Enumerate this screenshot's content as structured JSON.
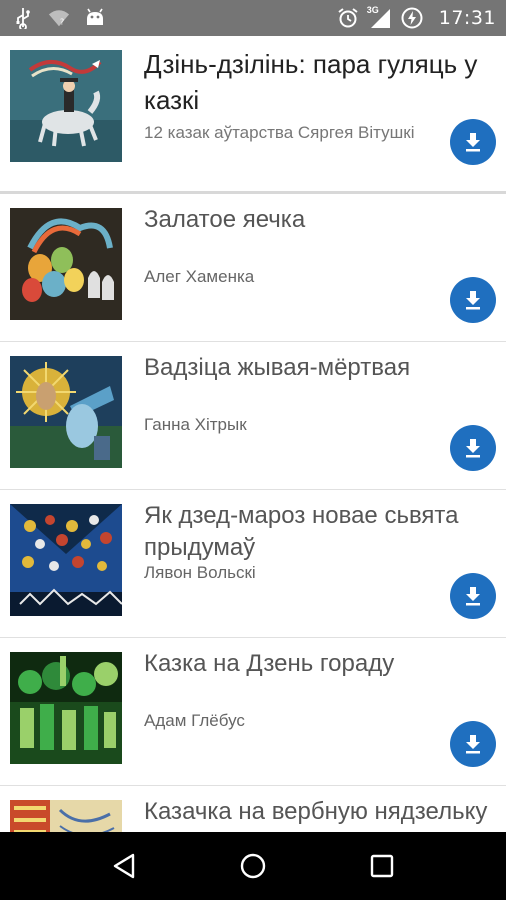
{
  "status_bar": {
    "time": "17:31",
    "network": "3G",
    "icons": [
      "usb-icon",
      "wifi-icon",
      "android-debug-icon",
      "alarm-icon",
      "signal-icon",
      "battery-charging-icon"
    ]
  },
  "books": [
    {
      "title": "Дзінь-дзілінь: пара гуляць у казкі",
      "author": "12 казак аўтарства Сяргея Вітушкі",
      "cover_colors": [
        "#3a6f7c",
        "#e0e4e6",
        "#c23a3a"
      ],
      "icon": "download-icon"
    },
    {
      "title": "Залатое яечка",
      "author": "Алег Хаменка",
      "cover_colors": [
        "#2f2a22",
        "#e8a53a",
        "#6bb0c8"
      ],
      "icon": "download-icon"
    },
    {
      "title": "Вадзіца жывая-мёртвая",
      "author": "Ганна Хітрык",
      "cover_colors": [
        "#1e3f5c",
        "#d9b23a",
        "#5ba0c8"
      ],
      "icon": "download-icon"
    },
    {
      "title": "Як дзед-мароз новае сьвята прыдумаў",
      "author": "Лявон Вольскі",
      "cover_colors": [
        "#1d4b8f",
        "#e2b93b",
        "#c4452f"
      ],
      "icon": "download-icon"
    },
    {
      "title": "Казка на Дзень гораду",
      "author": "Адам Глёбус",
      "cover_colors": [
        "#0f2a10",
        "#3fae4a",
        "#9ad06a"
      ],
      "icon": "download-icon"
    },
    {
      "title": "Казачка на вербную нядзельку",
      "author": "",
      "cover_colors": [
        "#c94a2a",
        "#e6d8a8",
        "#4a6fa8"
      ],
      "icon": "download-icon"
    }
  ],
  "accent_color": "#1f6fbf",
  "nav_bar": {
    "buttons": [
      "back-icon",
      "home-icon",
      "recents-icon"
    ]
  }
}
